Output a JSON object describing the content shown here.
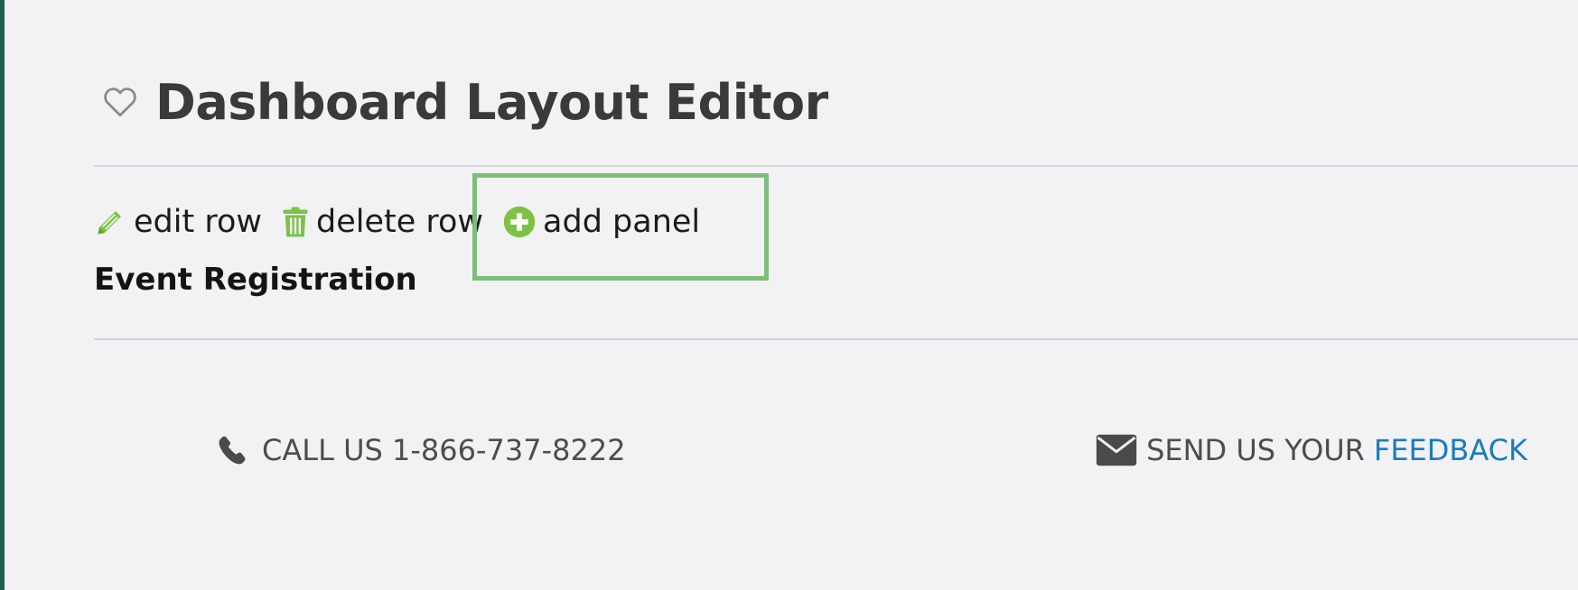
{
  "header": {
    "title": "Dashboard Layout Editor",
    "favorite_icon": "heart-outline-icon"
  },
  "row_actions": {
    "edit_label": "edit row",
    "delete_label": "delete row",
    "add_panel_label": "add panel",
    "icon_color": "#7dc247"
  },
  "row": {
    "label": "Event Registration"
  },
  "footer": {
    "call_text": "CALL US 1-866-737-8222",
    "feedback_prefix": "SEND US YOUR",
    "feedback_link": "FEEDBACK",
    "link_color": "#1a7bbf"
  },
  "highlight_color": "#7dbf7a"
}
